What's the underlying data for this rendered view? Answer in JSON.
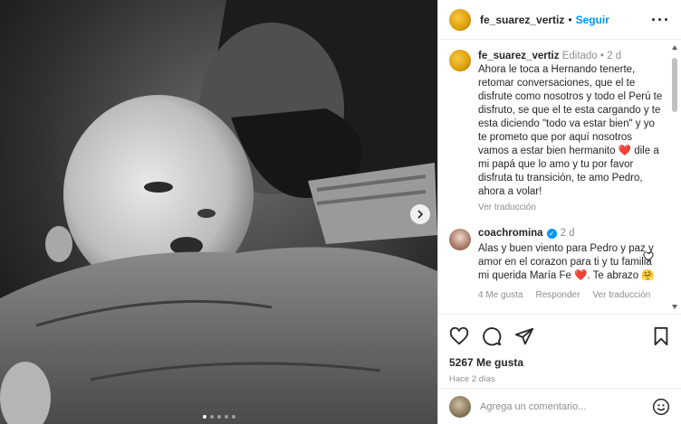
{
  "post": {
    "author": "fe_suarez_vertiz",
    "follow_label": "Seguir",
    "separator": "•",
    "more_icon": "more-horizontal-icon"
  },
  "caption": {
    "author": "fe_suarez_vertiz",
    "edited": "Editado",
    "separator": "•",
    "age": "2 d",
    "text_before_heart": "Ahora le toca a Hernando tenerte, retomar conversaciones, que el te disfrute como nosotros y todo el Perú te disfruto, se que el te esta cargando y te esta diciendo \"todo va estar bien\" y yo te prometo que por aquí nosotros vamos a estar bien hermanito",
    "heart": "❤️",
    "text_after_heart": "dile a mi papá que lo amo y tu por favor disfruta tu transición, te amo Pedro, ahora a volar!",
    "translate_label": "Ver traducción"
  },
  "comment": {
    "author": "coachromina",
    "verified_mark": "✓",
    "age": "2 d",
    "text_before_heart": "Alas y buen viento para Pedro y paz y amor en el corazon para ti y tu familia mi querida María Fe",
    "heart": "❤️",
    "text_after_heart": ". Te abrazo",
    "hug": "🤗",
    "likes_label": "4 Me gusta",
    "reply_label": "Responder",
    "translate_label": "Ver traducción"
  },
  "actions": {
    "likes": "5267 Me gusta",
    "time": "Hace 2 días",
    "add_comment_placeholder": "Agrega un comentario..."
  },
  "carousel": {
    "total": 5,
    "active_index": 0
  },
  "colors": {
    "link_blue": "#0095f6",
    "heart_red": "#ed4956",
    "muted_gray": "#8e8e8e"
  }
}
